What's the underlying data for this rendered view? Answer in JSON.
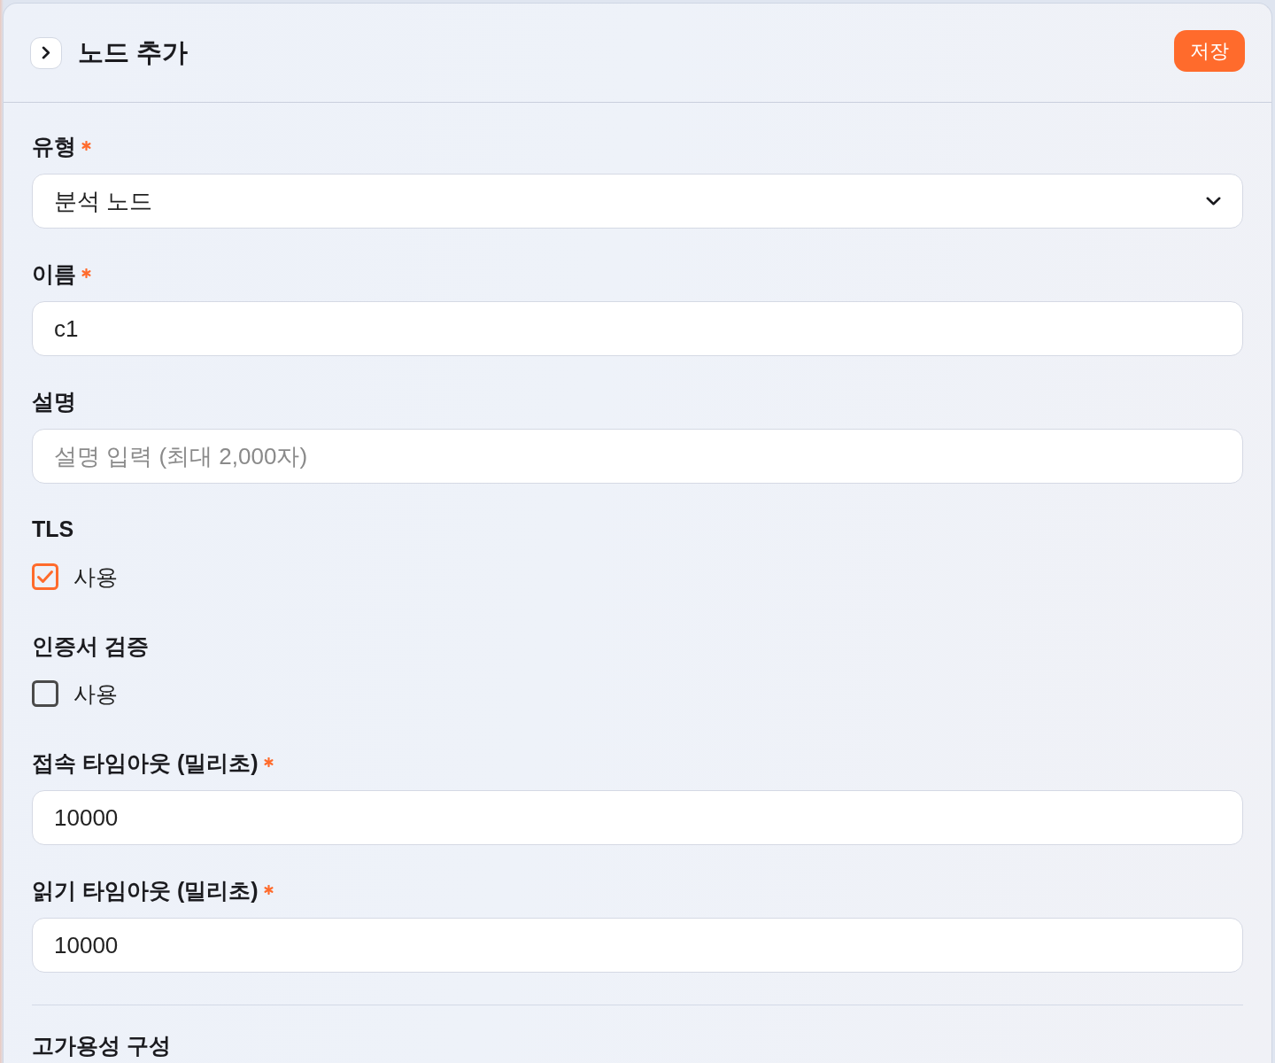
{
  "header": {
    "title": "노드 추가",
    "save_button": "저장"
  },
  "fields": [
    {
      "kind": "select",
      "label": "유형",
      "required": true,
      "value": "분석 노드"
    },
    {
      "kind": "text",
      "label": "이름",
      "required": true,
      "value": "c1"
    },
    {
      "kind": "text",
      "label": "설명",
      "required": false,
      "placeholder": "설명 입력 (최대 2,000자)"
    },
    {
      "kind": "checkbox",
      "label": "TLS",
      "required": false,
      "option": "사용",
      "checked": true
    },
    {
      "kind": "checkbox",
      "label": "인증서 검증",
      "required": false,
      "option": "사용",
      "checked": false
    },
    {
      "kind": "text",
      "label": "접속 타임아웃 (밀리초)",
      "required": true,
      "value": "10000"
    },
    {
      "kind": "text",
      "label": "읽기 타임아웃 (밀리초)",
      "required": true,
      "value": "10000"
    }
  ],
  "sections": [
    {
      "title": "고가용성 구성"
    }
  ]
}
